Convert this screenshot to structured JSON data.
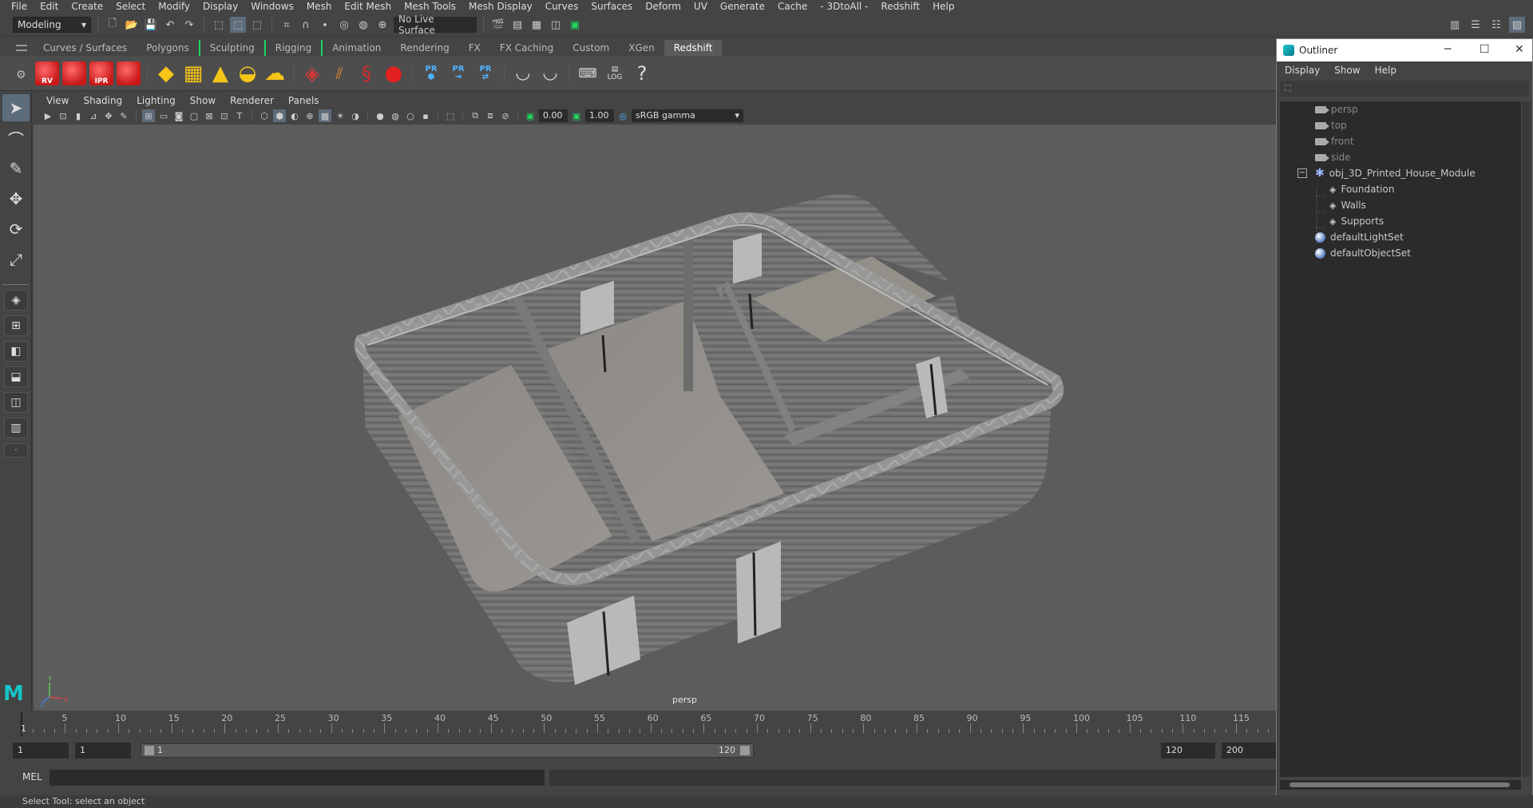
{
  "menubar": [
    "File",
    "Edit",
    "Create",
    "Select",
    "Modify",
    "Display",
    "Windows",
    "Mesh",
    "Edit Mesh",
    "Mesh Tools",
    "Mesh Display",
    "Curves",
    "Surfaces",
    "Deform",
    "UV",
    "Generate",
    "Cache",
    "- 3DtoAll -",
    "Redshift",
    "Help"
  ],
  "statusline": {
    "mode": "Modeling",
    "live_surface": "No Live Surface"
  },
  "shelf_tabs": [
    "Curves / Surfaces",
    "Polygons",
    "Sculpting",
    "Rigging",
    "Animation",
    "Rendering",
    "FX",
    "FX Caching",
    "Custom",
    "XGen",
    "Redshift"
  ],
  "shelf_active": "Redshift",
  "shelf_icon_labels": {
    "rv": "RV",
    "ipr": "IPR",
    "pr": "PR",
    "log": "LOG",
    "help": "?"
  },
  "viewport": {
    "menu": [
      "View",
      "Shading",
      "Lighting",
      "Show",
      "Renderer",
      "Panels"
    ],
    "exposure": "0.00",
    "gamma_value": "1.00",
    "color_space": "sRGB gamma",
    "camera_label": "persp",
    "axis_y": "Y",
    "axis_x": "X",
    "axis_z": "Z"
  },
  "outliner": {
    "title": "Outliner",
    "menu": [
      "Display",
      "Show",
      "Help"
    ],
    "items": [
      "persp",
      "top",
      "front",
      "side",
      "obj_3D_Printed_House_Module",
      "Foundation",
      "Walls",
      "Supports",
      "defaultLightSet",
      "defaultObjectSet"
    ]
  },
  "timeline": {
    "ticks": [
      "5",
      "10",
      "15",
      "20",
      "25",
      "30",
      "35",
      "40",
      "45",
      "50",
      "55",
      "60",
      "65",
      "70",
      "75",
      "80",
      "85",
      "90",
      "95",
      "100",
      "105",
      "110",
      "115"
    ],
    "current_frame": "1",
    "range_start": "1",
    "playback_start": "1",
    "range_start_inner": "1",
    "range_end_inner": "120",
    "playback_end": "120",
    "anim_end": "200"
  },
  "command_line": {
    "label": "MEL"
  },
  "help_line": "Select Tool: select an object",
  "colors": {
    "maya_teal": "#17c3c6",
    "shelf_highlight": "#1ed760",
    "redshift_red": "#c81818"
  }
}
